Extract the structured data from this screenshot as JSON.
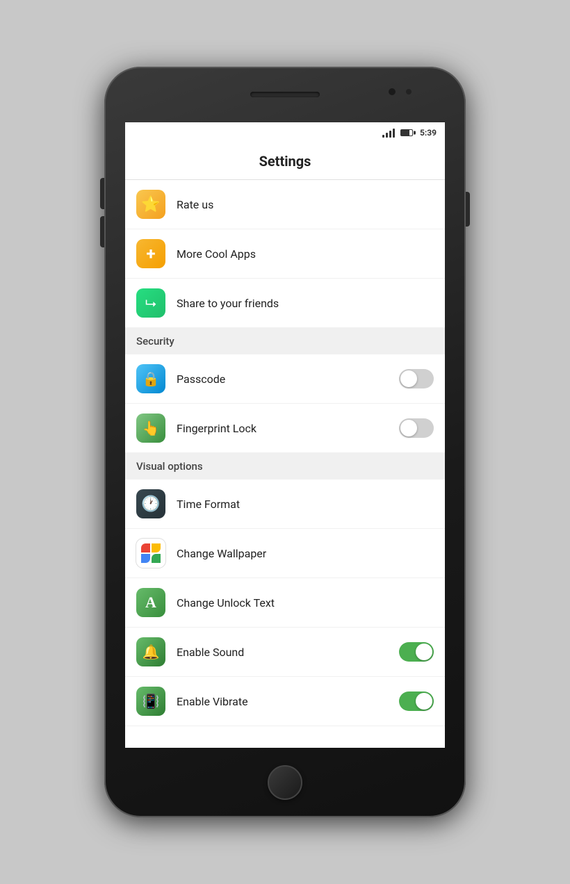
{
  "phone": {
    "status": {
      "time": "5:39",
      "battery": "75"
    }
  },
  "app": {
    "title": "Settings",
    "sections": {
      "general": {
        "items": [
          {
            "id": "rate-us",
            "label": "Rate us",
            "icon": "star",
            "hasToggle": false
          },
          {
            "id": "more-cool-apps",
            "label": "More Cool Apps",
            "icon": "plus",
            "hasToggle": false
          },
          {
            "id": "share-friends",
            "label": "Share to your friends",
            "icon": "share",
            "hasToggle": false
          }
        ]
      },
      "security": {
        "header": "Security",
        "items": [
          {
            "id": "passcode",
            "label": "Passcode",
            "icon": "passcode",
            "hasToggle": true,
            "toggleState": false
          },
          {
            "id": "fingerprint-lock",
            "label": "Fingerprint Lock",
            "icon": "fingerprint",
            "hasToggle": true,
            "toggleState": false
          }
        ]
      },
      "visual": {
        "header": "Visual options",
        "items": [
          {
            "id": "time-format",
            "label": "Time Format",
            "icon": "clock",
            "hasToggle": false
          },
          {
            "id": "change-wallpaper",
            "label": "Change Wallpaper",
            "icon": "wallpaper",
            "hasToggle": false
          },
          {
            "id": "change-unlock-text",
            "label": "Change Unlock Text",
            "icon": "text",
            "hasToggle": false
          },
          {
            "id": "enable-sound",
            "label": "Enable Sound",
            "icon": "sound",
            "hasToggle": true,
            "toggleState": true
          },
          {
            "id": "enable-vibrate",
            "label": "Enable Vibrate",
            "icon": "vibrate",
            "hasToggle": true,
            "toggleState": true
          }
        ]
      }
    }
  }
}
